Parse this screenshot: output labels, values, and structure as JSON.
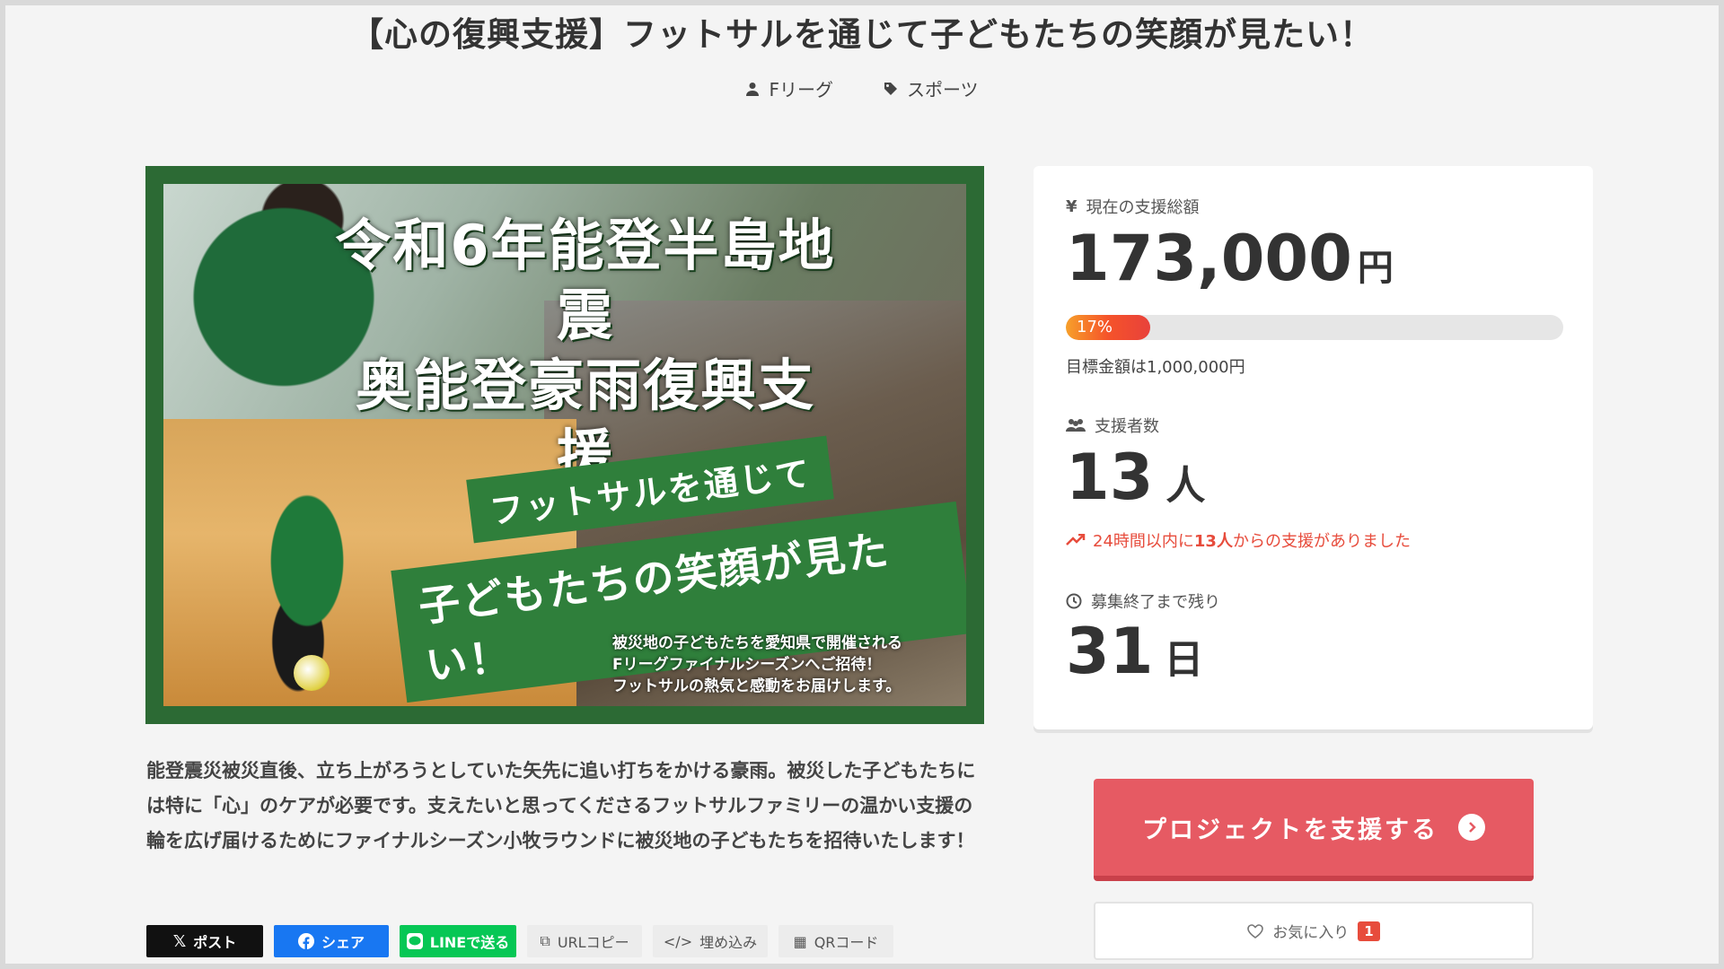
{
  "header": {
    "title": "【心の復興支援】フットサルを通じて子どもたちの笑顔が見たい！",
    "owner": "Fリーグ",
    "category": "スポーツ"
  },
  "hero": {
    "headline_1": "令和6年能登半島地震",
    "headline_2": "奥能登豪雨復興支援",
    "ribbon_1": "フットサルを通じて",
    "ribbon_2": "子どもたちの笑顔が見たい！",
    "sub_1": "被災地の子どもたちを愛知県で開催される",
    "sub_2": "Fリーグファイナルシーズンへご招待！",
    "sub_3": "フットサルの熱気と感動をお届けします。"
  },
  "description": "能登震災被災直後、立ち上がろうとしていた矢先に追い打ちをかける豪雨。被災した子どもたちには特に「心」のケアが必要です。支えたいと思ってくださるフットサルファミリーの温かい支援の輪を広げ届けるためにファイナルシーズン小牧ラウンドに被災地の子どもたちを招待いたします！",
  "share": {
    "x": "ポスト",
    "facebook": "シェア",
    "line": "LINEで送る",
    "url": "URLコピー",
    "embed": "埋め込み",
    "qr": "QRコード"
  },
  "stats": {
    "amount_label": "現在の支援総額",
    "amount": "173,000",
    "amount_unit": "円",
    "progress_percent": 17,
    "progress_label": "17%",
    "goal": "目標金額は1,000,000円",
    "supporters_label": "支援者数",
    "supporters": "13",
    "supporters_unit": "人",
    "recent_prefix": "24時間以内に",
    "recent_count": "13人",
    "recent_suffix": "からの支援がありました",
    "remaining_label": "募集終了まで残り",
    "remaining": "31",
    "remaining_unit": "日"
  },
  "actions": {
    "support": "プロジェクトを支援する",
    "favorite": "お気に入り",
    "favorite_count": "1"
  },
  "colors": {
    "accent": "#e65a63",
    "trend": "#e74c3c",
    "progress_start": "#f7a02a",
    "progress_end": "#e8413b"
  }
}
